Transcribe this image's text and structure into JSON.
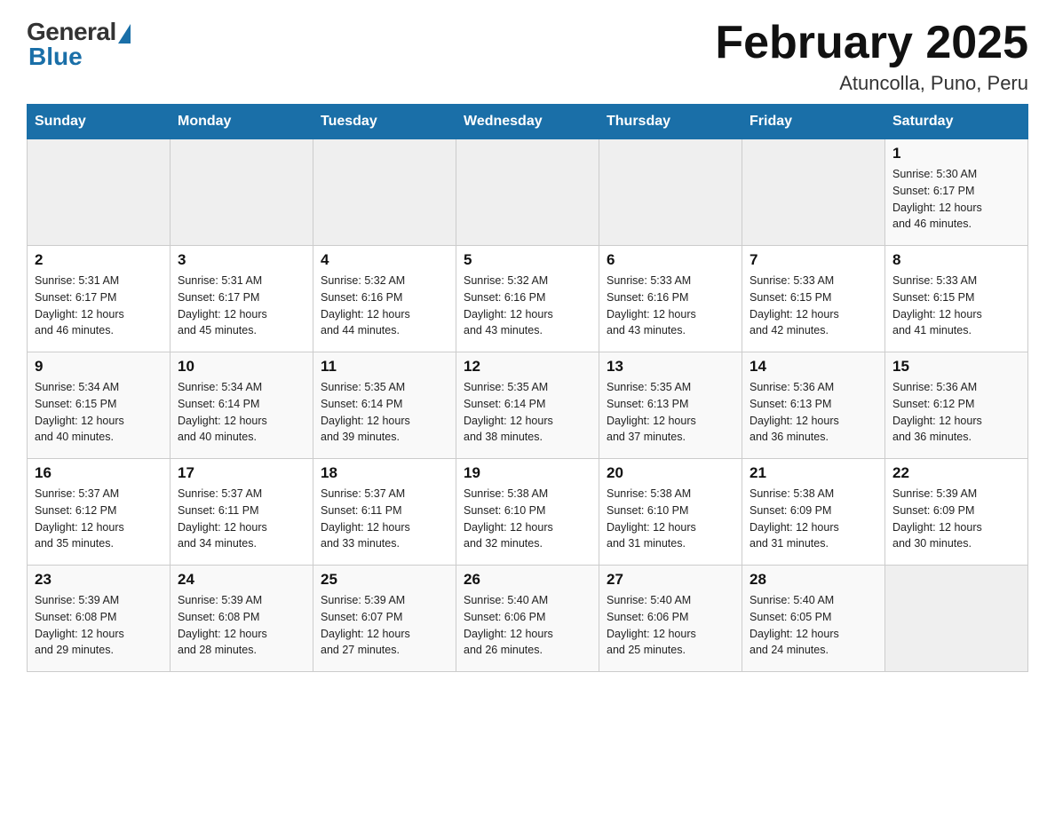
{
  "header": {
    "logo_general": "General",
    "logo_blue": "Blue",
    "month_title": "February 2025",
    "location": "Atuncolla, Puno, Peru"
  },
  "days_of_week": [
    "Sunday",
    "Monday",
    "Tuesday",
    "Wednesday",
    "Thursday",
    "Friday",
    "Saturday"
  ],
  "weeks": [
    [
      {
        "day": "",
        "info": ""
      },
      {
        "day": "",
        "info": ""
      },
      {
        "day": "",
        "info": ""
      },
      {
        "day": "",
        "info": ""
      },
      {
        "day": "",
        "info": ""
      },
      {
        "day": "",
        "info": ""
      },
      {
        "day": "1",
        "info": "Sunrise: 5:30 AM\nSunset: 6:17 PM\nDaylight: 12 hours\nand 46 minutes."
      }
    ],
    [
      {
        "day": "2",
        "info": "Sunrise: 5:31 AM\nSunset: 6:17 PM\nDaylight: 12 hours\nand 46 minutes."
      },
      {
        "day": "3",
        "info": "Sunrise: 5:31 AM\nSunset: 6:17 PM\nDaylight: 12 hours\nand 45 minutes."
      },
      {
        "day": "4",
        "info": "Sunrise: 5:32 AM\nSunset: 6:16 PM\nDaylight: 12 hours\nand 44 minutes."
      },
      {
        "day": "5",
        "info": "Sunrise: 5:32 AM\nSunset: 6:16 PM\nDaylight: 12 hours\nand 43 minutes."
      },
      {
        "day": "6",
        "info": "Sunrise: 5:33 AM\nSunset: 6:16 PM\nDaylight: 12 hours\nand 43 minutes."
      },
      {
        "day": "7",
        "info": "Sunrise: 5:33 AM\nSunset: 6:15 PM\nDaylight: 12 hours\nand 42 minutes."
      },
      {
        "day": "8",
        "info": "Sunrise: 5:33 AM\nSunset: 6:15 PM\nDaylight: 12 hours\nand 41 minutes."
      }
    ],
    [
      {
        "day": "9",
        "info": "Sunrise: 5:34 AM\nSunset: 6:15 PM\nDaylight: 12 hours\nand 40 minutes."
      },
      {
        "day": "10",
        "info": "Sunrise: 5:34 AM\nSunset: 6:14 PM\nDaylight: 12 hours\nand 40 minutes."
      },
      {
        "day": "11",
        "info": "Sunrise: 5:35 AM\nSunset: 6:14 PM\nDaylight: 12 hours\nand 39 minutes."
      },
      {
        "day": "12",
        "info": "Sunrise: 5:35 AM\nSunset: 6:14 PM\nDaylight: 12 hours\nand 38 minutes."
      },
      {
        "day": "13",
        "info": "Sunrise: 5:35 AM\nSunset: 6:13 PM\nDaylight: 12 hours\nand 37 minutes."
      },
      {
        "day": "14",
        "info": "Sunrise: 5:36 AM\nSunset: 6:13 PM\nDaylight: 12 hours\nand 36 minutes."
      },
      {
        "day": "15",
        "info": "Sunrise: 5:36 AM\nSunset: 6:12 PM\nDaylight: 12 hours\nand 36 minutes."
      }
    ],
    [
      {
        "day": "16",
        "info": "Sunrise: 5:37 AM\nSunset: 6:12 PM\nDaylight: 12 hours\nand 35 minutes."
      },
      {
        "day": "17",
        "info": "Sunrise: 5:37 AM\nSunset: 6:11 PM\nDaylight: 12 hours\nand 34 minutes."
      },
      {
        "day": "18",
        "info": "Sunrise: 5:37 AM\nSunset: 6:11 PM\nDaylight: 12 hours\nand 33 minutes."
      },
      {
        "day": "19",
        "info": "Sunrise: 5:38 AM\nSunset: 6:10 PM\nDaylight: 12 hours\nand 32 minutes."
      },
      {
        "day": "20",
        "info": "Sunrise: 5:38 AM\nSunset: 6:10 PM\nDaylight: 12 hours\nand 31 minutes."
      },
      {
        "day": "21",
        "info": "Sunrise: 5:38 AM\nSunset: 6:09 PM\nDaylight: 12 hours\nand 31 minutes."
      },
      {
        "day": "22",
        "info": "Sunrise: 5:39 AM\nSunset: 6:09 PM\nDaylight: 12 hours\nand 30 minutes."
      }
    ],
    [
      {
        "day": "23",
        "info": "Sunrise: 5:39 AM\nSunset: 6:08 PM\nDaylight: 12 hours\nand 29 minutes."
      },
      {
        "day": "24",
        "info": "Sunrise: 5:39 AM\nSunset: 6:08 PM\nDaylight: 12 hours\nand 28 minutes."
      },
      {
        "day": "25",
        "info": "Sunrise: 5:39 AM\nSunset: 6:07 PM\nDaylight: 12 hours\nand 27 minutes."
      },
      {
        "day": "26",
        "info": "Sunrise: 5:40 AM\nSunset: 6:06 PM\nDaylight: 12 hours\nand 26 minutes."
      },
      {
        "day": "27",
        "info": "Sunrise: 5:40 AM\nSunset: 6:06 PM\nDaylight: 12 hours\nand 25 minutes."
      },
      {
        "day": "28",
        "info": "Sunrise: 5:40 AM\nSunset: 6:05 PM\nDaylight: 12 hours\nand 24 minutes."
      },
      {
        "day": "",
        "info": ""
      }
    ]
  ]
}
